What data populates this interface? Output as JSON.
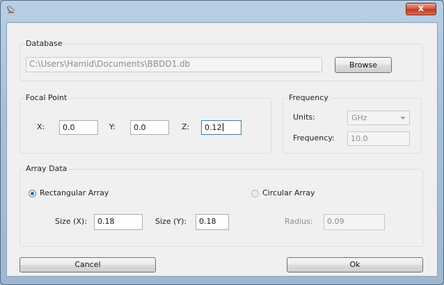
{
  "window": {
    "title": "",
    "close_label": "x"
  },
  "database": {
    "group_title": "Database",
    "path_value": "C:\\Users\\Hamid\\Documents\\BBDD1.db",
    "browse_label": "Browse"
  },
  "focal_point": {
    "group_title": "Focal Point",
    "x_label": "X:",
    "x_value": "0.0",
    "y_label": "Y:",
    "y_value": "0.0",
    "z_label": "Z:",
    "z_value": "0.12"
  },
  "frequency": {
    "group_title": "Frequency",
    "units_label": "Units:",
    "units_value": "GHz",
    "frequency_label": "Frequency:",
    "frequency_value": "10.0"
  },
  "array_data": {
    "group_title": "Array Data",
    "rectangular_label": "Rectangular Array",
    "rectangular_selected": true,
    "circular_label": "Circular Array",
    "circular_selected": false,
    "size_x_label": "Size (X):",
    "size_x_value": "0.18",
    "size_y_label": "Size (Y):",
    "size_y_value": "0.18",
    "radius_label": "Radius:",
    "radius_value": "0.09"
  },
  "buttons": {
    "cancel_label": "Cancel",
    "ok_label": "Ok"
  },
  "colors": {
    "titlebar": "#b9cfe4",
    "close": "#c03a22",
    "client": "#f0f0f0",
    "accent": "#2a6db3"
  },
  "icons": {
    "app": "satellite-dish-icon",
    "close": "close-icon"
  }
}
